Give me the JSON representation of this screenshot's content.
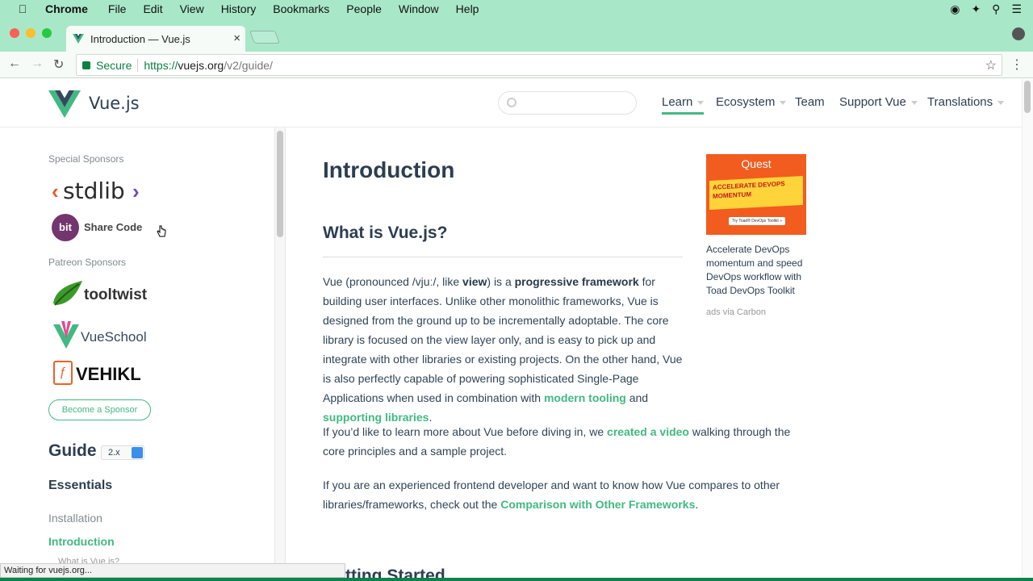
{
  "menubar": {
    "app": "Chrome",
    "items": [
      "File",
      "Edit",
      "View",
      "History",
      "Bookmarks",
      "People",
      "Window",
      "Help"
    ]
  },
  "tab": {
    "title": "Introduction — Vue.js"
  },
  "address": {
    "secure_label": "Secure",
    "scheme": "https://",
    "host": "vuejs.org",
    "path": "/v2/guide/"
  },
  "header": {
    "brand": "Vue.js",
    "search_placeholder": "",
    "nav": [
      "Learn",
      "Ecosystem",
      "Team",
      "Support Vue",
      "Translations"
    ]
  },
  "sidebar": {
    "special_sponsors_label": "Special Sponsors",
    "sponsor_stdlib": "stdlib",
    "sponsor_bit_badge": "bit",
    "sponsor_bit_text": "Share Code",
    "patreon_label": "Patreon Sponsors",
    "sponsor_tooltwist": "tooltwist",
    "sponsor_vueschool": "VueSchool",
    "sponsor_vehikl": "VEHIKL",
    "become_sponsor": "Become a Sponsor",
    "guide_title": "Guide",
    "version": "2.x",
    "section": "Essentials",
    "links": [
      "Installation",
      "Introduction",
      "What is Vue.js?"
    ]
  },
  "main": {
    "title": "Introduction",
    "h2": "What is Vue.js?",
    "p1_a": "Vue (pronounced /vjuː/, like ",
    "p1_view": "view",
    "p1_b": ") is a ",
    "p1_pf": "progressive framework",
    "p1_c": " for building user interfaces. Unlike other monolithic frameworks, Vue is designed from the ground up to be incrementally adoptable. The core library is focused on the view layer only, and is easy to pick up and integrate with other libraries or existing projects. On the other hand, Vue is also perfectly capable of powering sophisticated Single-Page Applications when used in combination with ",
    "p1_link1": "modern tooling",
    "p1_d": " and ",
    "p1_link2": "supporting libraries",
    "p1_e": ".",
    "p2_a": "If you’d like to learn more about Vue before diving in, we ",
    "p2_link": "created a video",
    "p2_b": " walking through the core principles and a sample project.",
    "p3_a": "If you are an experienced frontend developer and want to know how Vue compares to other libraries/frameworks, check out the ",
    "p3_link": "Comparison with Other Frameworks",
    "p3_b": ".",
    "next_heading": "Getting Started"
  },
  "ad": {
    "brand": "Quest",
    "banner": "ACCELERATE DEVOPS MOMENTUM",
    "cta": "Try Toad® DevOps Toolkit »",
    "text": "Accelerate DevOps momentum and speed DevOps workflow with Toad DevOps Toolkit",
    "via": "ads via Carbon"
  },
  "status": "Waiting for vuejs.org...",
  "colors": {
    "accent": "#42b983",
    "chrome_bg": "#a9e7c9",
    "text": "#2c3e50"
  }
}
